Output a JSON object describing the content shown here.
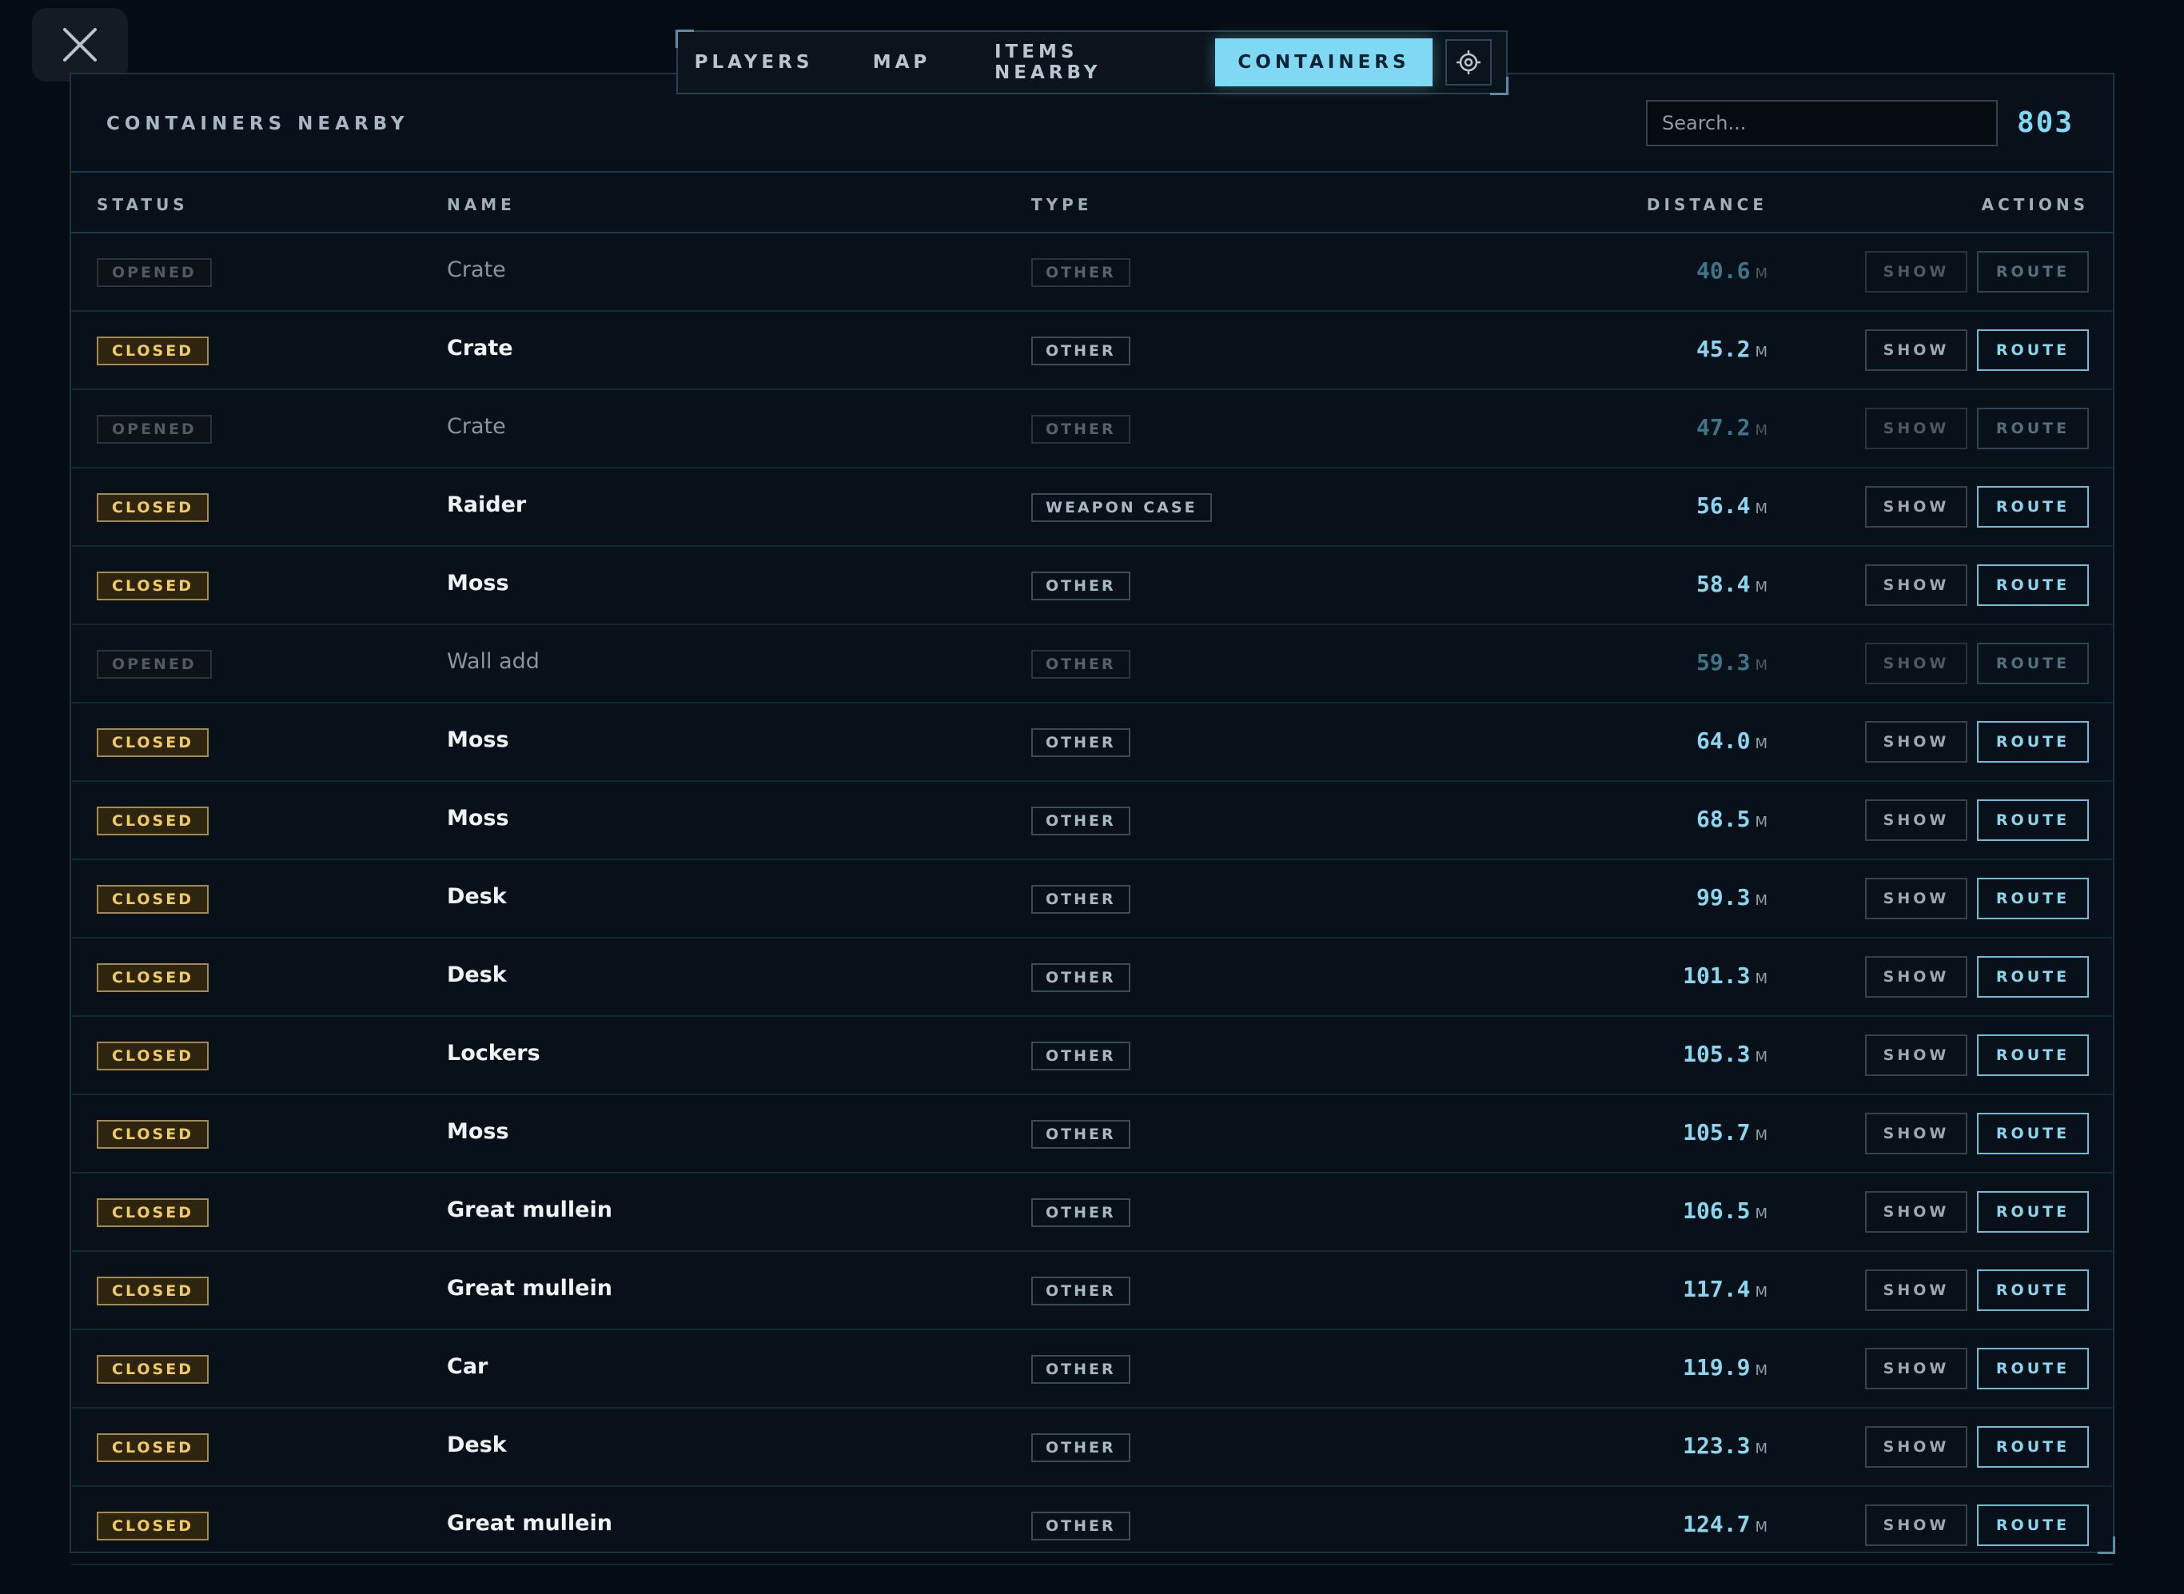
{
  "tabs": [
    {
      "label": "PLAYERS"
    },
    {
      "label": "MAP"
    },
    {
      "label": "ITEMS NEARBY"
    },
    {
      "label": "CONTAINERS"
    }
  ],
  "header": {
    "title": "CONTAINERS NEARBY",
    "search_placeholder": "Search...",
    "count": "803"
  },
  "columns": {
    "status": "STATUS",
    "name": "NAME",
    "type": "TYPE",
    "distance": "DISTANCE",
    "actions": "ACTIONS"
  },
  "actions": {
    "show": "SHOW",
    "route": "ROUTE"
  },
  "unit": "M",
  "rows": [
    {
      "status": "OPENED",
      "name": "Crate",
      "type": "OTHER",
      "distance": "40.6"
    },
    {
      "status": "CLOSED",
      "name": "Crate",
      "type": "OTHER",
      "distance": "45.2"
    },
    {
      "status": "OPENED",
      "name": "Crate",
      "type": "OTHER",
      "distance": "47.2"
    },
    {
      "status": "CLOSED",
      "name": "Raider",
      "type": "WEAPON CASE",
      "distance": "56.4"
    },
    {
      "status": "CLOSED",
      "name": "Moss",
      "type": "OTHER",
      "distance": "58.4"
    },
    {
      "status": "OPENED",
      "name": "Wall add",
      "type": "OTHER",
      "distance": "59.3"
    },
    {
      "status": "CLOSED",
      "name": "Moss",
      "type": "OTHER",
      "distance": "64.0"
    },
    {
      "status": "CLOSED",
      "name": "Moss",
      "type": "OTHER",
      "distance": "68.5"
    },
    {
      "status": "CLOSED",
      "name": "Desk",
      "type": "OTHER",
      "distance": "99.3"
    },
    {
      "status": "CLOSED",
      "name": "Desk",
      "type": "OTHER",
      "distance": "101.3"
    },
    {
      "status": "CLOSED",
      "name": "Lockers",
      "type": "OTHER",
      "distance": "105.3"
    },
    {
      "status": "CLOSED",
      "name": "Moss",
      "type": "OTHER",
      "distance": "105.7"
    },
    {
      "status": "CLOSED",
      "name": "Great mullein",
      "type": "OTHER",
      "distance": "106.5"
    },
    {
      "status": "CLOSED",
      "name": "Great mullein",
      "type": "OTHER",
      "distance": "117.4"
    },
    {
      "status": "CLOSED",
      "name": "Car",
      "type": "OTHER",
      "distance": "119.9"
    },
    {
      "status": "CLOSED",
      "name": "Desk",
      "type": "OTHER",
      "distance": "123.3"
    },
    {
      "status": "CLOSED",
      "name": "Great mullein",
      "type": "OTHER",
      "distance": "124.7"
    }
  ],
  "colors": {
    "accent": "#7fd9f5",
    "closed": "#f2cb60",
    "background": "#060c13"
  }
}
